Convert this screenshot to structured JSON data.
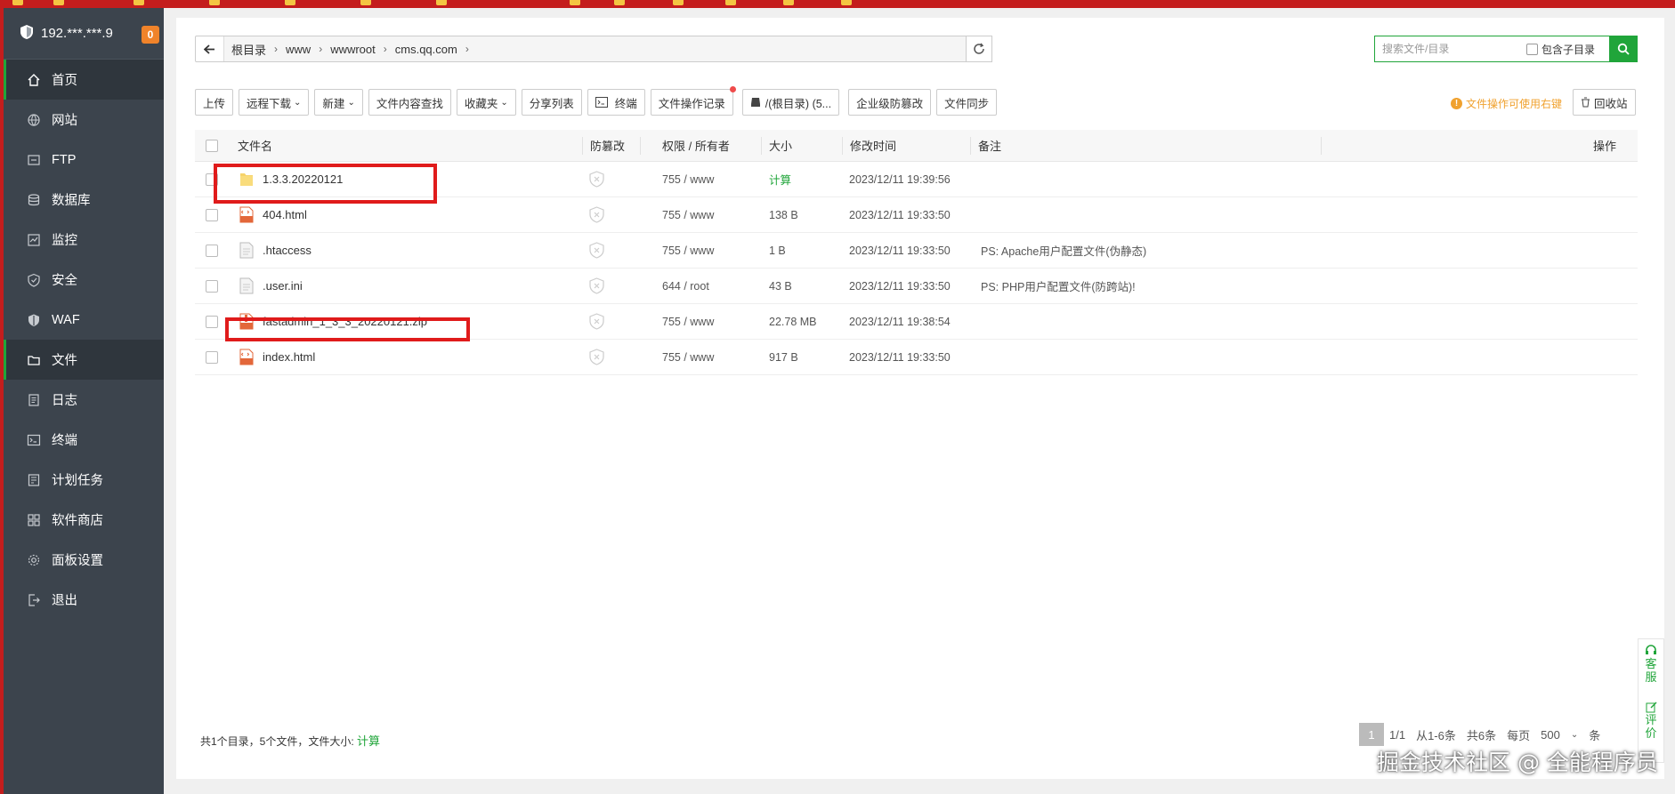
{
  "sidebar": {
    "ip": "192.***.***.9",
    "badge": "0",
    "items": [
      {
        "label": "首页",
        "icon": "home-icon"
      },
      {
        "label": "网站",
        "icon": "globe-icon"
      },
      {
        "label": "FTP",
        "icon": "ftp-icon"
      },
      {
        "label": "数据库",
        "icon": "database-icon"
      },
      {
        "label": "监控",
        "icon": "monitor-icon"
      },
      {
        "label": "安全",
        "icon": "shield-icon"
      },
      {
        "label": "WAF",
        "icon": "waf-icon"
      },
      {
        "label": "文件",
        "icon": "folder-icon"
      },
      {
        "label": "日志",
        "icon": "log-icon"
      },
      {
        "label": "终端",
        "icon": "terminal-icon"
      },
      {
        "label": "计划任务",
        "icon": "clock-icon"
      },
      {
        "label": "软件商店",
        "icon": "apps-icon"
      },
      {
        "label": "面板设置",
        "icon": "settings-icon"
      },
      {
        "label": "退出",
        "icon": "logout-icon"
      }
    ]
  },
  "path": {
    "crumbs": [
      "根目录",
      "www",
      "wwwroot",
      "cms.qq.com"
    ]
  },
  "search": {
    "placeholder": "搜索文件/目录",
    "include_sub": "包含子目录"
  },
  "toolbar": {
    "upload": "上传",
    "remote_download": "远程下载",
    "new": "新建",
    "content_search": "文件内容查找",
    "favorites": "收藏夹",
    "share_list": "分享列表",
    "terminal": "终端",
    "op_log": "文件操作记录",
    "disk": "/(根目录) (5...",
    "tamper": "企业级防篡改",
    "sync": "文件同步",
    "tip": "文件操作可使用右键",
    "recycle": "回收站"
  },
  "table": {
    "headers": {
      "name": "文件名",
      "tamper": "防篡改",
      "perm": "权限 / 所有者",
      "size": "大小",
      "mtime": "修改时间",
      "note": "备注",
      "ops": "操作"
    },
    "rows": [
      {
        "name": "1.3.3.20220121",
        "type": "folder",
        "perm": "755 / www",
        "size": "计算",
        "mtime": "2023/12/11 19:39:56",
        "note": ""
      },
      {
        "name": "404.html",
        "type": "html",
        "perm": "755 / www",
        "size": "138 B",
        "mtime": "2023/12/11 19:33:50",
        "note": ""
      },
      {
        "name": ".htaccess",
        "type": "text",
        "perm": "755 / www",
        "size": "1 B",
        "mtime": "2023/12/11 19:33:50",
        "note": "PS: Apache用户配置文件(伪静态)"
      },
      {
        "name": ".user.ini",
        "type": "text",
        "perm": "644 / root",
        "size": "43 B",
        "mtime": "2023/12/11 19:33:50",
        "note": "PS: PHP用户配置文件(防跨站)!"
      },
      {
        "name": "fastadmin_1_3_3_20220121.zip",
        "type": "zip",
        "perm": "755 / www",
        "size": "22.78 MB",
        "mtime": "2023/12/11 19:38:54",
        "note": ""
      },
      {
        "name": "index.html",
        "type": "html",
        "perm": "755 / www",
        "size": "917 B",
        "mtime": "2023/12/11 19:33:50",
        "note": ""
      }
    ]
  },
  "footer": {
    "summary": "共1个目录，5个文件，文件大小:",
    "calc": "计算",
    "page": "1",
    "pages": "1/1",
    "range": "从1-6条",
    "total": "共6条",
    "per_page_label": "每页",
    "per_page": "500",
    "unit": "条"
  },
  "service": {
    "support": "客服",
    "review": "评价"
  },
  "watermark": "掘金技术社区 @ 全能程序员",
  "colors": {
    "accent": "#20a53a",
    "sidebar": "#3c444d",
    "annotation": "#e01b1b"
  }
}
